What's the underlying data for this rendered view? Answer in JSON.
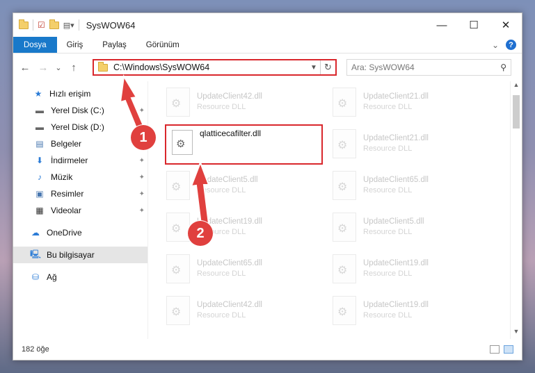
{
  "window": {
    "title": "SysWOW64",
    "minimize": "—",
    "maximize": "☐",
    "close": "✕"
  },
  "ribbon": {
    "tabs": [
      "Dosya",
      "Giriş",
      "Paylaş",
      "Görünüm"
    ],
    "expand": "⌄",
    "help": "?"
  },
  "nav": {
    "back": "←",
    "forward": "→",
    "recent": "⌄",
    "up": "↑",
    "address": "C:\\Windows\\SysWOW64",
    "search_placeholder": "Ara: SysWOW64"
  },
  "sidebar": {
    "items": [
      {
        "label": "Hızlı erişim",
        "icon": "star-icon"
      },
      {
        "label": "Yerel Disk (C:)",
        "icon": "drive-icon"
      },
      {
        "label": "Yerel Disk (D:)",
        "icon": "drive-icon"
      },
      {
        "label": "Belgeler",
        "icon": "documents-icon"
      },
      {
        "label": "İndirmeler",
        "icon": "download-icon"
      },
      {
        "label": "Müzik",
        "icon": "music-icon"
      },
      {
        "label": "Resimler",
        "icon": "pictures-icon"
      },
      {
        "label": "Videolar",
        "icon": "videos-icon"
      },
      {
        "label": "OneDrive",
        "icon": "cloud-icon"
      },
      {
        "label": "Bu bilgisayar",
        "icon": "computer-icon"
      },
      {
        "label": "Ağ",
        "icon": "network-icon"
      }
    ]
  },
  "files": [
    {
      "name": "UpdateClient42.dll",
      "type": "Resource DLL"
    },
    {
      "name": "UpdateClient21.dll",
      "type": "Resource DLL"
    },
    {
      "name": "UpdateClient21.dll",
      "type": "Resource DLL"
    },
    {
      "name": "UpdateClient5.dll",
      "type": "Resource DLL"
    },
    {
      "name": "UpdateClient65.dll",
      "type": "Resource DLL"
    },
    {
      "name": "UpdateClient19.dll",
      "type": "Resource DLL"
    },
    {
      "name": "UpdateClient5.dll",
      "type": "Resource DLL"
    },
    {
      "name": "UpdateClient65.dll",
      "type": "Resource DLL"
    },
    {
      "name": "UpdateClient19.dll",
      "type": "Resource DLL"
    },
    {
      "name": "UpdateClient42.dll",
      "type": "Resource DLL"
    },
    {
      "name": "UpdateClient19.dll",
      "type": "Resource DLL"
    }
  ],
  "highlighted_file": {
    "name": "qlatticecafilter.dll"
  },
  "status": {
    "count": "182 öğe"
  },
  "annotations": {
    "badge1": "1",
    "badge2": "2",
    "color": "#e0403e"
  }
}
